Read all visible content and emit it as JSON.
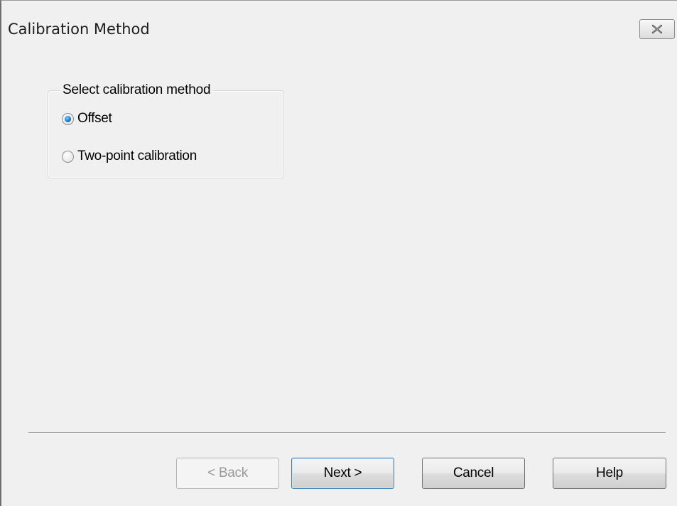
{
  "window": {
    "title": "Calibration Method"
  },
  "group": {
    "legend": "Select calibration method",
    "options": [
      {
        "label": "Offset",
        "selected": true
      },
      {
        "label": "Two-point calibration",
        "selected": false
      }
    ]
  },
  "buttons": {
    "back": "< Back",
    "next": "Next >",
    "cancel": "Cancel",
    "help": "Help"
  },
  "icons": {
    "close": "close-icon"
  },
  "colors": {
    "background": "#f0f0f0",
    "radio_selected": "#1c78c4",
    "disabled_text": "#9a9a9a"
  }
}
